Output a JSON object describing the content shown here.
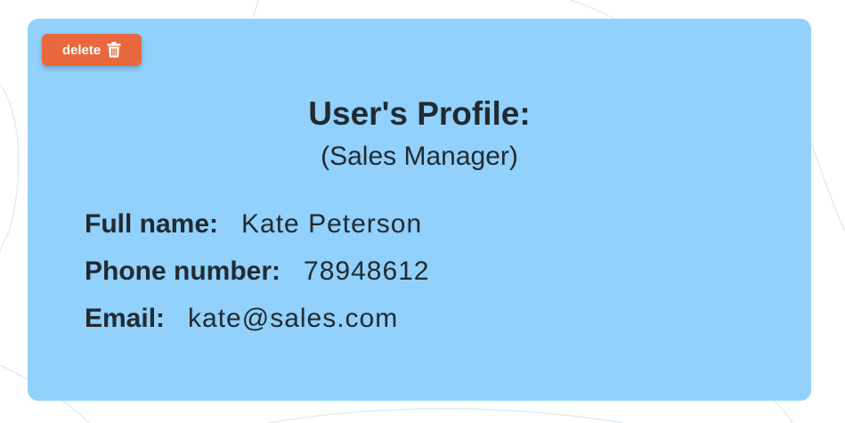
{
  "delete_button": {
    "label": "delete",
    "icon": "trash-icon"
  },
  "profile": {
    "title": "User's Profile:",
    "subtitle": "(Sales Manager)",
    "fields": [
      {
        "label": "Full name:",
        "value": "Kate Peterson"
      },
      {
        "label": "Phone number:",
        "value": "78948612"
      },
      {
        "label": "Email:",
        "value": "kate@sales.com"
      }
    ]
  },
  "colors": {
    "card_background": "#91d1fc",
    "delete_button": "#e9683e",
    "text": "#222a30",
    "page_background": "#ffffff"
  }
}
